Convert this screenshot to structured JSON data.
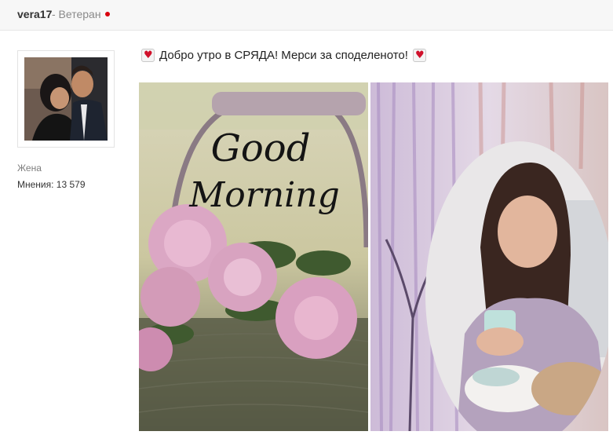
{
  "header": {
    "username": "vera17",
    "rank": "- Ветеран",
    "status_color": "#d9000d"
  },
  "sidebar": {
    "gender": "Жена",
    "posts": "Мнения: 13 579"
  },
  "post": {
    "text": "Добро утро в СРЯДА! Мерси за споделеното!",
    "emoji_icon": "heart-icon"
  },
  "images": {
    "left_caption_1": "Good",
    "left_caption_2": "Morning"
  }
}
